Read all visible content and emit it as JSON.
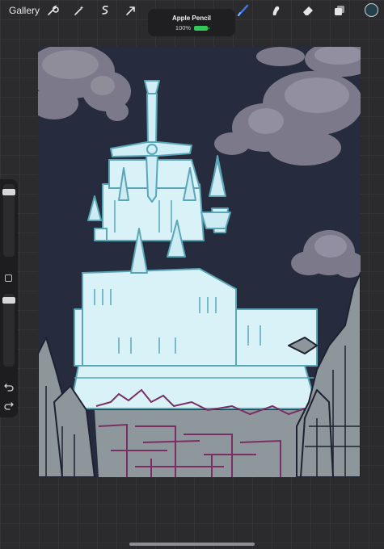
{
  "topbar": {
    "gallery_label": "Gallery",
    "tools_left": [
      "wrench-icon",
      "magic-wand-icon",
      "selection-icon",
      "transform-arrow-icon"
    ],
    "tools_right": [
      "brush-icon",
      "smudge-icon",
      "eraser-icon",
      "layers-icon",
      "color-swatch-icon"
    ],
    "active_color": "#24414b",
    "accent_color": "#3c7bf2"
  },
  "notice": {
    "title": "Apple Pencil",
    "battery_text": "100%",
    "battery_level": 1.0
  },
  "sidebar": {
    "brush_size_level": 0.06,
    "opacity_level": 0.04
  }
}
